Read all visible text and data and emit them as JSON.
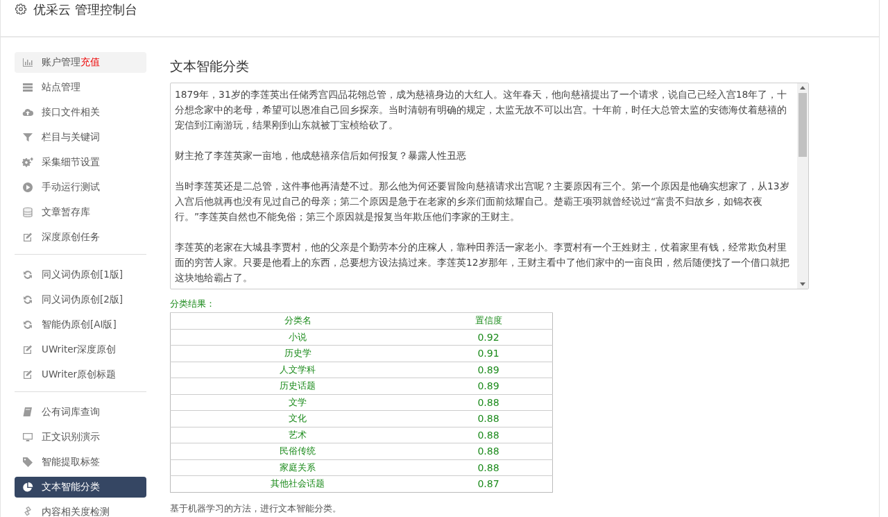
{
  "header": {
    "title": "优采云 管理控制台"
  },
  "sidebar": {
    "groups": [
      [
        {
          "label": "账户管理",
          "badge": "充值",
          "hovered": true,
          "selected": false
        },
        {
          "label": "站点管理",
          "hovered": false,
          "selected": false
        },
        {
          "label": "接口文件相关",
          "hovered": false,
          "selected": false
        },
        {
          "label": "栏目与关键词",
          "hovered": false,
          "selected": false
        },
        {
          "label": "采集细节设置",
          "hovered": false,
          "selected": false
        },
        {
          "label": "手动运行测试",
          "hovered": false,
          "selected": false
        },
        {
          "label": "文章暂存库",
          "hovered": false,
          "selected": false
        },
        {
          "label": "深度原创任务",
          "hovered": false,
          "selected": false
        }
      ],
      [
        {
          "label": "同义词伪原创[1版]",
          "hovered": false,
          "selected": false
        },
        {
          "label": "同义词伪原创[2版]",
          "hovered": false,
          "selected": false
        },
        {
          "label": "智能伪原创[AI版]",
          "hovered": false,
          "selected": false
        },
        {
          "label": "UWriter深度原创",
          "hovered": false,
          "selected": false
        },
        {
          "label": "UWriter原创标题",
          "hovered": false,
          "selected": false
        }
      ],
      [
        {
          "label": "公有词库查询",
          "hovered": false,
          "selected": false
        },
        {
          "label": "正文识别演示",
          "hovered": false,
          "selected": false
        },
        {
          "label": "智能提取标签",
          "hovered": false,
          "selected": false
        },
        {
          "label": "文本智能分类",
          "hovered": false,
          "selected": true
        },
        {
          "label": "内容相关度检测",
          "hovered": false,
          "selected": false
        }
      ]
    ]
  },
  "main": {
    "heading": "文本智能分类",
    "text_area": {
      "paragraphs": [
        "1879年，31岁的李莲英出任储秀宫四品花翎总管，成为慈禧身边的大红人。这年春天，他向慈禧提出了一个请求，说自己已经入宫18年了，十分想念家中的老母，希望可以恩准自己回乡探亲。当时清朝有明确的规定，太监无故不可以出宫。十年前，时任大总管太监的安德海仗着慈禧的宠信到江南游玩，结果刚到山东就被丁宝桢给砍了。",
        "财主抢了李莲英家一亩地，他成慈禧亲信后如何报复？暴露人性丑恶",
        "当时李莲英还是二总管，这件事他再清楚不过。那么他为何还要冒险向慈禧请求出宫呢？主要原因有三个。第一个原因是他确实想家了，从13岁入宫后他就再也没有见过自己的母亲；第二个原因是急于在老家的乡亲们面前炫耀自己。楚霸王项羽就曾经说过“富贵不归故乡，如锦衣夜行。”李莲英自然也不能免俗；第三个原因就是报复当年欺压他们李家的王财主。",
        "李莲英的老家在大城县李贾村，他的父亲是个勤劳本分的庄稼人，靠种田养活一家老小。李贾村有一个王姓财主，仗着家里有钱，经常欺负村里面的穷苦人家。只要是他看上的东西，总要想方设法搞过来。李莲英12岁那年，王财主看中了他们家中的一亩良田，然后随便找了一个借口就把这块地给霸占了。"
      ]
    },
    "result_label": "分类结果：",
    "table": {
      "columns": [
        "分类名",
        "置信度"
      ],
      "rows": [
        [
          "小说",
          "0.92"
        ],
        [
          "历史学",
          "0.91"
        ],
        [
          "人文学科",
          "0.89"
        ],
        [
          "历史话题",
          "0.89"
        ],
        [
          "文学",
          "0.88"
        ],
        [
          "文化",
          "0.88"
        ],
        [
          "艺术",
          "0.88"
        ],
        [
          "民俗传统",
          "0.88"
        ],
        [
          "家庭关系",
          "0.88"
        ],
        [
          "其他社会话题",
          "0.87"
        ]
      ]
    },
    "description": "基于机器学习的方法，进行文本智能分类。"
  }
}
